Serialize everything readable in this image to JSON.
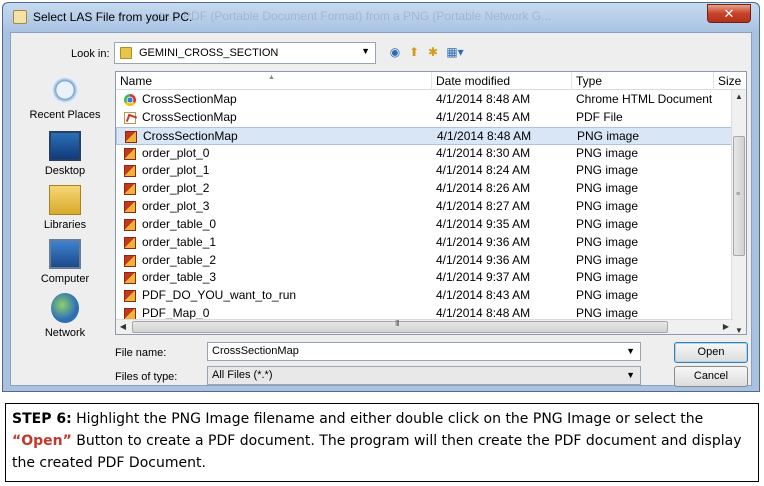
{
  "window": {
    "title": "Select LAS File from your PC.",
    "close_label": "✕",
    "ghost_text": "...ate a PDF (Portable Document Format) from a PNG (Portable Network G..."
  },
  "lookin": {
    "label": "Look in:",
    "value": "GEMINI_CROSS_SECTION"
  },
  "places": [
    {
      "label": "Recent Places",
      "icon": "recent-places-icon"
    },
    {
      "label": "Desktop",
      "icon": "desktop-icon"
    },
    {
      "label": "Libraries",
      "icon": "libraries-icon"
    },
    {
      "label": "Computer",
      "icon": "computer-icon"
    },
    {
      "label": "Network",
      "icon": "network-icon"
    }
  ],
  "columns": {
    "name": "Name",
    "date": "Date modified",
    "type": "Type",
    "size": "Size"
  },
  "files": [
    {
      "name": "CrossSectionMap",
      "date": "4/1/2014 8:48 AM",
      "type": "Chrome HTML Document",
      "icon": "chrome-file-icon"
    },
    {
      "name": "CrossSectionMap",
      "date": "4/1/2014 8:45 AM",
      "type": "PDF File",
      "icon": "pdf-file-icon"
    },
    {
      "name": "CrossSectionMap",
      "date": "4/1/2014 8:48 AM",
      "type": "PNG image",
      "icon": "png-file-icon",
      "selected": true
    },
    {
      "name": "order_plot_0",
      "date": "4/1/2014 8:30 AM",
      "type": "PNG image",
      "icon": "png-file-icon"
    },
    {
      "name": "order_plot_1",
      "date": "4/1/2014 8:24 AM",
      "type": "PNG image",
      "icon": "png-file-icon"
    },
    {
      "name": "order_plot_2",
      "date": "4/1/2014 8:26 AM",
      "type": "PNG image",
      "icon": "png-file-icon"
    },
    {
      "name": "order_plot_3",
      "date": "4/1/2014 8:27 AM",
      "type": "PNG image",
      "icon": "png-file-icon"
    },
    {
      "name": "order_table_0",
      "date": "4/1/2014 9:35 AM",
      "type": "PNG image",
      "icon": "png-file-icon"
    },
    {
      "name": "order_table_1",
      "date": "4/1/2014 9:36 AM",
      "type": "PNG image",
      "icon": "png-file-icon"
    },
    {
      "name": "order_table_2",
      "date": "4/1/2014 9:36 AM",
      "type": "PNG image",
      "icon": "png-file-icon"
    },
    {
      "name": "order_table_3",
      "date": "4/1/2014 9:37 AM",
      "type": "PNG image",
      "icon": "png-file-icon"
    },
    {
      "name": "PDF_DO_YOU_want_to_run",
      "date": "4/1/2014 8:43 AM",
      "type": "PNG image",
      "icon": "png-file-icon"
    },
    {
      "name": "PDF_Map_0",
      "date": "4/1/2014 8:48 AM",
      "type": "PNG image",
      "icon": "png-file-icon"
    }
  ],
  "filename": {
    "label": "File name:",
    "value": "CrossSectionMap"
  },
  "filetype": {
    "label": "Files of type:",
    "value": "All Files (*.*)"
  },
  "buttons": {
    "open": "Open",
    "cancel": "Cancel"
  },
  "caption": {
    "step": "STEP 6:",
    "part1": " Highlight the PNG Image filename and either double click on the PNG Image or select the ",
    "open": "“Open”",
    "part2": " Button to create a PDF document.  The program will then create the PDF document and display the created PDF Document."
  }
}
